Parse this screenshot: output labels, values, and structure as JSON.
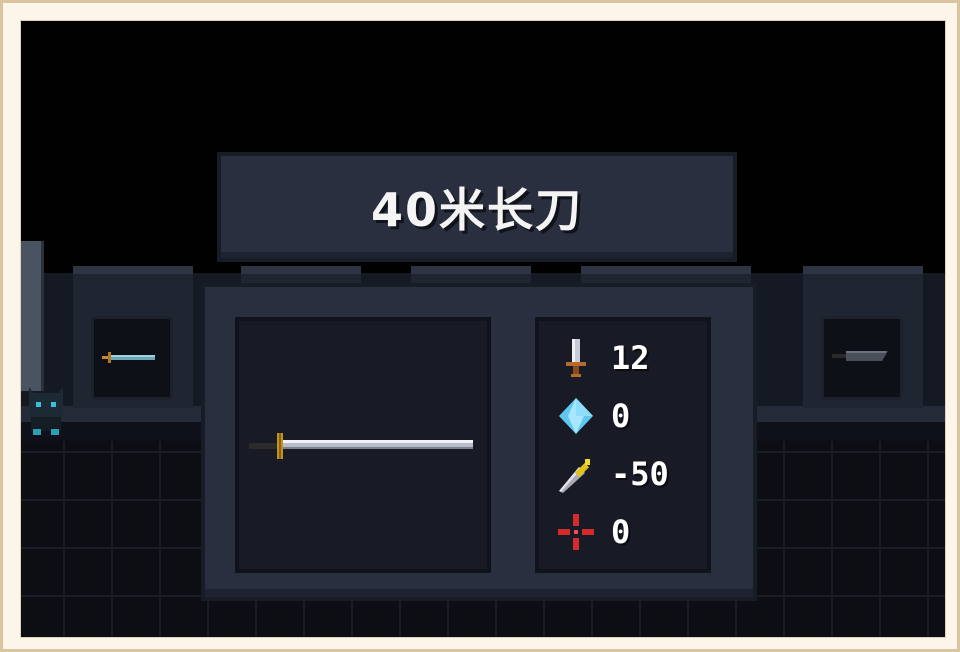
{
  "weapon": {
    "name": "40米长刀"
  },
  "stats": [
    {
      "icon": "sword-damage-icon",
      "value": "12"
    },
    {
      "icon": "energy-crystal-icon",
      "value": "0"
    },
    {
      "icon": "dagger-accuracy-icon",
      "value": "-50"
    },
    {
      "icon": "crosshair-crit-icon",
      "value": "0"
    }
  ],
  "colors": {
    "panel": "#2a2f3f",
    "panel_border": "#181c27",
    "inner_box": "#181b25",
    "text": "#ffffff",
    "background": "#010102"
  }
}
